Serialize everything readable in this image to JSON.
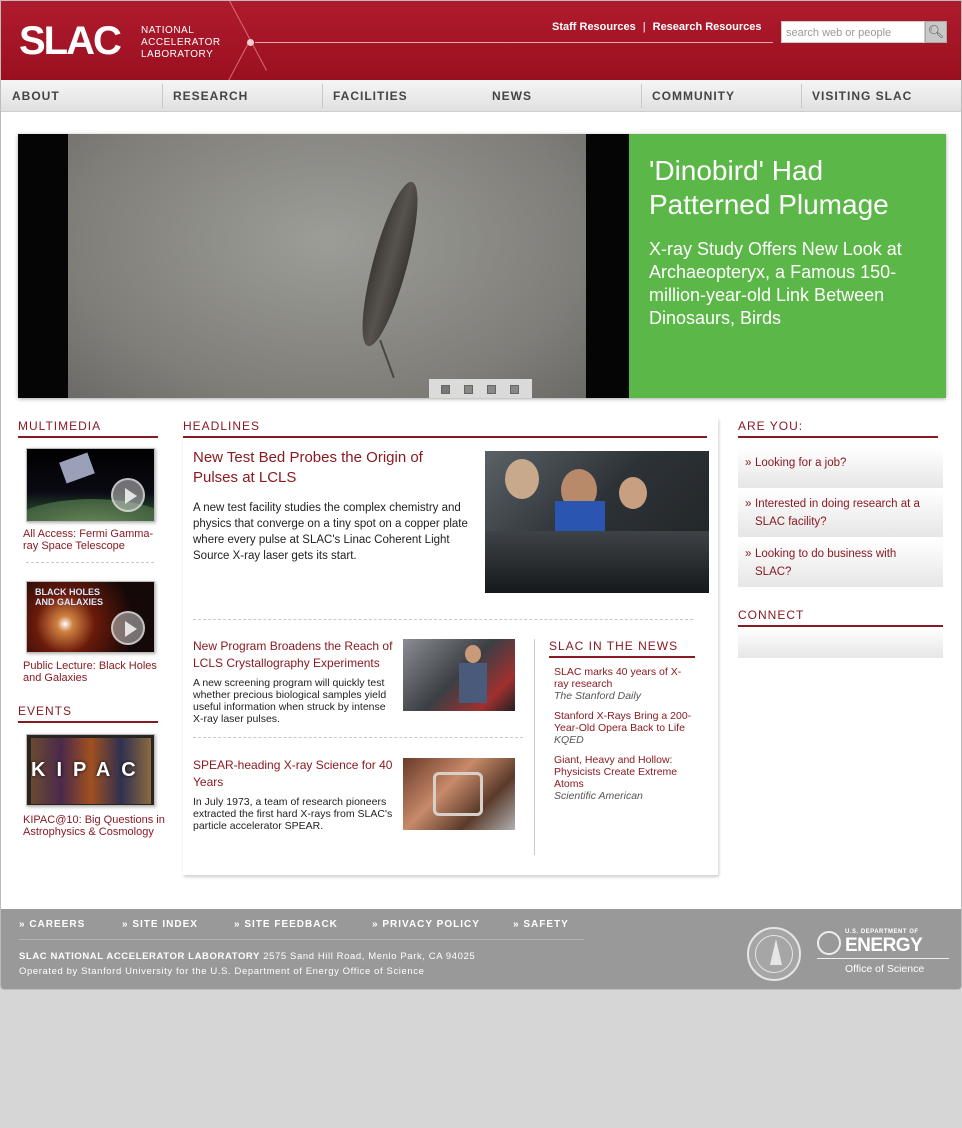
{
  "header": {
    "logo_word": "SLAC",
    "logo_sub": [
      "NATIONAL",
      "ACCELERATOR",
      "LABORATORY"
    ],
    "links": [
      "Staff Resources",
      "Research Resources"
    ],
    "search_placeholder": "search web or people"
  },
  "nav": [
    "ABOUT",
    "RESEARCH",
    "FACILITIES",
    "NEWS",
    "COMMUNITY",
    "VISITING SLAC"
  ],
  "hero": {
    "title": "'Dinobird' Had Patterned Plumage",
    "subtitle": "X-ray Study Offers New Look at Archaeopteryx, a Famous 150-million-year-old Link Between Dinosaurs, Birds",
    "slide_count": 4
  },
  "multimedia": {
    "heading": "MULTIMEDIA",
    "items": [
      {
        "caption": "All Access: Fermi Gamma-ray Space Telescope"
      },
      {
        "caption": "Public Lecture: Black Holes and Galaxies",
        "thumb_text": [
          "BLACK HOLES",
          "AND GALAXIES"
        ]
      }
    ]
  },
  "events": {
    "heading": "EVENTS",
    "items": [
      {
        "caption": "KIPAC@10: Big Questions in Astrophysics & Cosmology",
        "thumb_text": "KIPAC"
      }
    ]
  },
  "headlines": {
    "heading": "HEADLINES",
    "lead": {
      "title": "New Test Bed Probes the Origin of Pulses at LCLS",
      "body": "A new test facility studies the complex chemistry and physics that converge on a tiny spot on a copper plate where every pulse at SLAC's Linac Coherent Light Source X-ray laser gets its start."
    },
    "stories": [
      {
        "title": "New Program Broadens the Reach of LCLS Crystallography Experiments",
        "body": "A new screening program will quickly test whether precious biological samples yield useful information when struck by intense X-ray laser pulses."
      },
      {
        "title": "SPEAR-heading X-ray Science for 40 Years",
        "body": "In July 1973, a team of research pioneers extracted the first hard X-rays from SLAC's particle accelerator SPEAR."
      }
    ]
  },
  "in_the_news": {
    "heading": "SLAC IN THE NEWS",
    "items": [
      {
        "title": "SLAC marks 40 years of X-ray research",
        "source": "The Stanford Daily"
      },
      {
        "title": "Stanford X-Rays Bring a 200-Year-Old Opera Back to Life",
        "source": "KQED"
      },
      {
        "title": "Giant, Heavy and Hollow: Physicists Create Extreme Atoms",
        "source": "Scientific American"
      }
    ]
  },
  "are_you": {
    "heading": "ARE YOU:",
    "items": [
      "Looking for a job?",
      "Interested in doing research at a SLAC facility?",
      "Looking to do business with SLAC?"
    ]
  },
  "connect": {
    "heading": "CONNECT"
  },
  "footer": {
    "links": [
      "» CAREERS",
      "» SITE INDEX",
      "» SITE FEEDBACK",
      "» PRIVACY POLICY",
      "» SAFETY"
    ],
    "address_bold": "SLAC NATIONAL ACCELERATOR LABORATORY",
    "address": "2575 Sand Hill Road, Menlo Park, CA 94025",
    "operated": "Operated by Stanford University for the U.S. Department of Energy Office of Science",
    "doe_small": "U.S. DEPARTMENT OF",
    "doe_big": "ENERGY",
    "doe_office": "Office of Science"
  },
  "colors": {
    "brand": "#9a1020",
    "hero_green": "#5bb747",
    "link": "#8a1a22",
    "footer": "#999999"
  }
}
